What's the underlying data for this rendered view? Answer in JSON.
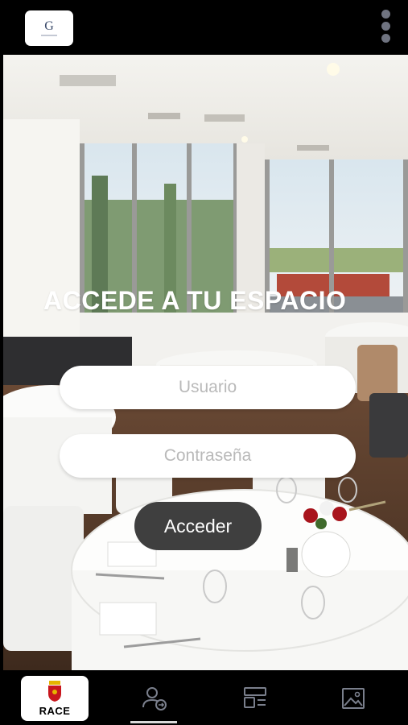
{
  "header": {
    "logo_icon": "company-logo",
    "menu_icon": "kebab-menu-icon"
  },
  "login": {
    "title": "ACCEDE A TU ESPACIO",
    "username_placeholder": "Usuario",
    "password_placeholder": "Contraseña",
    "submit_label": "Acceder"
  },
  "bottom_nav": {
    "brand_label": "RACE",
    "items": [
      {
        "icon": "user-login-icon",
        "active": true
      },
      {
        "icon": "layout-panels-icon",
        "active": false
      },
      {
        "icon": "image-gallery-icon",
        "active": false
      }
    ]
  },
  "colors": {
    "bar_background": "#000000",
    "button_background": "#3f3f3f",
    "input_background": "#ffffff",
    "placeholder_text": "#b9b9b9"
  }
}
